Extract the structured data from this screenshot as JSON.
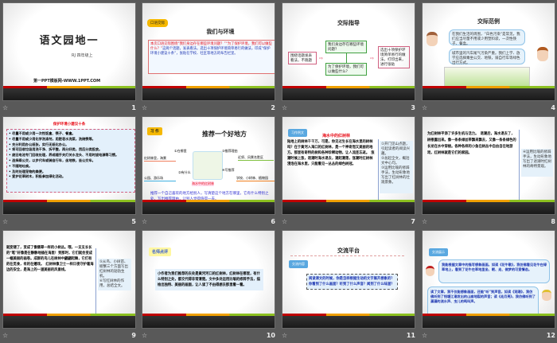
{
  "slides": [
    {
      "number": "1",
      "title": "语文园地一",
      "subtitle": "RJ  四年级上",
      "footer": "第一PPT模板网-WWW.1PPT.COM"
    },
    {
      "number": "2",
      "tag": "口语交际",
      "title": "我们与环境",
      "body_red": "本次口语交际围绕“我们身边存在哪些环境问题？”“为了保护环境，我们可以做些什么？”",
      "body_blue": "这两个话题，发表看法。选出十项保护环境简单易行的做法，印成“保护环境小建议十条”，张贴在学校、社区等地方的布告栏里。"
    },
    {
      "number": "3",
      "title": "交际指导",
      "left_box": "围绕话题发表看法，不跑题",
      "top_box": "我们身边存在哪些环境问题？",
      "bottom_box": "为了保护环境，我们可以做些什么？",
      "right_box": "选出十项保护环境简单易行的做法，打印出来，进行张贴"
    },
    {
      "number": "4",
      "title": "交际范例",
      "bubble1": "在我们生活的周围，“白色污染”是常见。我们应当尽量不用或少用塑料袋，一次性筷子、餐盒。",
      "bubble2": "城市里的汽车尾气污染严重。我们上学、放学应选择乘坐公交、地铁，骑自行车等绿色出行方式。"
    },
    {
      "number": "5",
      "title": "保护环境小建议十条",
      "items": [
        "尽量不用或少用一次性饭盒、筷子、餐盒。",
        "尽量不用或少用化学洗涤剂，用肥皂水洗菜，洗碗筷等。",
        "充分利用办公纸张，实行无纸化办公。",
        "将可回收垃圾用洗干净、拆平整，再分好类，然后分类投放。",
        "废旧电池专门回收处理，养成随手关灯关水龙头、不用时拔电源等习惯。",
        "选择乘公交，以步代车或骑自行车，坐地铁，坐公交车。",
        "不随地吐痰。",
        "及时处理宠物的粪便。",
        "爱护花草树木，积极参加绿化活动。"
      ]
    },
    {
      "number": "6",
      "tag": "习 作",
      "title": "推荐一个好地方",
      "center": "海水中的红树林",
      "branches": [
        "①在哪里",
        "②有什么",
        "③推荐理由",
        "④写推荐"
      ],
      "leaves": [
        "红树林里，海景",
        "公园、游乐场",
        "近郊、风景名胜区",
        "学校、小树林、植物园"
      ],
      "body": "推荐一个自己喜欢的地方给别人，写清楚这个地方在哪里，它有什么特别之处，写出推荐理由，让别人觉得值得一去。"
    },
    {
      "number": "7",
      "tag": "习作例文",
      "title": "海水中的红树林",
      "body": "陆地上的树林千千万，可是，你见过生长在海水里的树林吗？在于黄河入海口的红树林，是一个神奇而又美丽的地方。那里有奇特的树和各种珍稀动物，让人流连忘返。　涨潮时候上涨，退潮时海水退去，潮起潮落，涨潮时红树林浸泡在海水里，只能看见一丛丛的绿色树冠。",
      "notes": [
        "①开门见山点题，引起读者的阅读兴趣。",
        "②总起全文，概括文中心句。",
        "③运用比喻的修辞手法，生动形象地写出了红树林的壮观景象。"
      ]
    },
    {
      "number": "8",
      "body": "为红树林平添了许多生机与活力。　退潮后，海水退去了，树根露出来。像一条条绿丝带飘来飘去，又像一条条绿色的长龙在水中穿梭。各种各样的小鱼在树丛中自由自在地游戏，红树林就是它们的家园。",
      "notes": [
        "④运用比喻的修辞手法，生动形象地写出了退潮时红树林的奇特景观。"
      ]
    },
    {
      "number": "9",
      "body": "就变矮了，变成了像翡翠一样的小树丛。哦，一支支长长的“笔”好像是在静静地插在海里！到那时，它们就会变成一幅美丽的画卷。成群的鸟儿在树林中翩翩起舞，它们有的在觅食，有的在嬉戏。　红树林像卫士一样日夜守护着海边的安全，是海上的一道美丽的风景线。",
      "notes": [
        "⑤从鸟、小树苗、螃蟹三个方面写出红树林的勃勃生机。",
        "⑥写红树林的作用，总结全文。"
      ]
    },
    {
      "number": "10",
      "tag": "名师点评",
      "body": "小作者为我们推荐的去处是黄河河口的红树林，红树林在哪里，有什么特别之处，都交代得非常清楚。文中多处运用比喻的修辞手法，描绘出独特、美丽的画面，让人读了不由得想去那里看一看。"
    },
    {
      "number": "11",
      "title": "交流平台",
      "tag": "交流内容",
      "body": "阅读课文的时候，你是怎样根据生动的文字展开想象的？你看到了什么画面？听到了什么声音？闻到了什么味道？"
    },
    {
      "number": "12",
      "tag": "交流展示",
      "bubble1": "我能根据文章中的描写想象画面。如读《花牛歌》，我仿佛看见花牛在绿草地上，看到了花牛在草地里坐、眠、走、做梦的可爱情态。",
      "bubble2": "读了文章，我不仅能想象画面，还能“听”到声音。如读《观潮》，我仿佛听到了钱塘江潮发出的山崩地裂的声音；读《走月亮》，我仿佛听到了潺潺的流水声、虫儿的鸣叫声。"
    }
  ],
  "colors": {
    "accent_red": "#e8101a",
    "accent_blue": "#1a33b0",
    "tag_yellow": "#f5b800",
    "tag_blue": "#5aa8e0"
  }
}
